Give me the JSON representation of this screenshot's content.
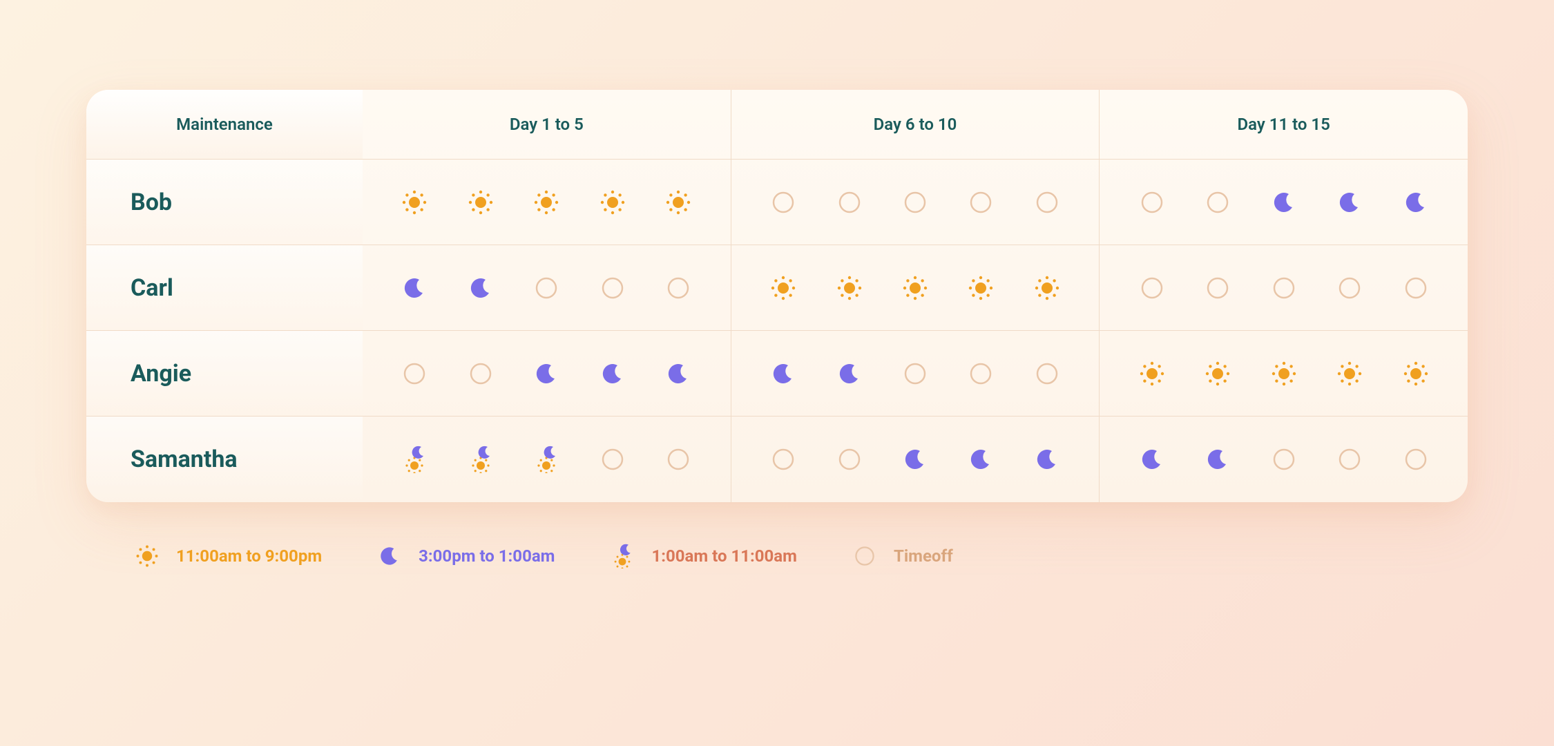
{
  "header": {
    "title": "Maintenance",
    "periods": [
      "Day 1 to 5",
      "Day 6 to 10",
      "Day 11 to 15"
    ]
  },
  "employees": [
    {
      "name": "Bob",
      "shifts": [
        "sun",
        "sun",
        "sun",
        "sun",
        "sun",
        "off",
        "off",
        "off",
        "off",
        "off",
        "off",
        "off",
        "moon",
        "moon",
        "moon"
      ]
    },
    {
      "name": "Carl",
      "shifts": [
        "moon",
        "moon",
        "off",
        "off",
        "off",
        "sun",
        "sun",
        "sun",
        "sun",
        "sun",
        "off",
        "off",
        "off",
        "off",
        "off"
      ]
    },
    {
      "name": "Angie",
      "shifts": [
        "off",
        "off",
        "moon",
        "moon",
        "moon",
        "moon",
        "moon",
        "off",
        "off",
        "off",
        "sun",
        "sun",
        "sun",
        "sun",
        "sun"
      ]
    },
    {
      "name": "Samantha",
      "shifts": [
        "combo",
        "combo",
        "combo",
        "off",
        "off",
        "off",
        "off",
        "moon",
        "moon",
        "moon",
        "moon",
        "moon",
        "off",
        "off",
        "off"
      ]
    }
  ],
  "legend": {
    "sun": "11:00am to 9:00pm",
    "moon": "3:00pm to 1:00am",
    "combo": "1:00am to 11:00am",
    "off": "Timeoff"
  },
  "colors": {
    "sun": "#f0a020",
    "moon": "#7a6de8",
    "offStroke": "#e8c5a8",
    "comboSun": "#f0a020",
    "comboMoon": "#7a6de8"
  }
}
